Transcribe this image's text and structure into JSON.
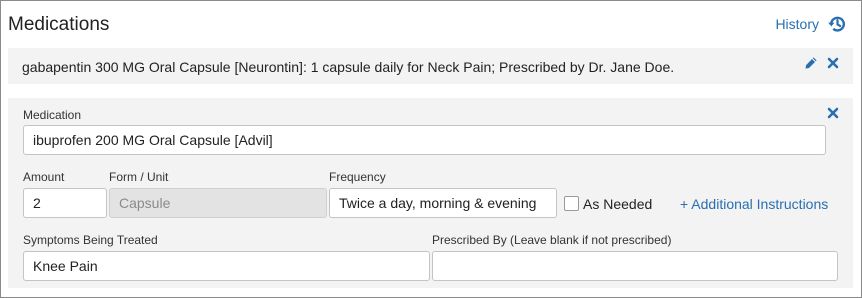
{
  "header": {
    "title": "Medications",
    "history_label": "History",
    "history_icon": "history-icon"
  },
  "existing_medication": {
    "summary": "gabapentin 300 MG Oral Capsule [Neurontin]: 1 capsule daily for Neck Pain; Prescribed by Dr. Jane Doe.",
    "edit_icon": "pencil-icon",
    "remove_icon": "close-icon"
  },
  "form": {
    "close_icon": "close-icon",
    "medication_label": "Medication",
    "medication_value": "ibuprofen 200 MG Oral Capsule [Advil]",
    "amount_label": "Amount",
    "amount_value": "2",
    "form_unit_label": "Form / Unit",
    "form_unit_value": "Capsule",
    "frequency_label": "Frequency",
    "frequency_value": "Twice a day, morning & evening",
    "as_needed_label": "As Needed",
    "as_needed_checked": false,
    "additional_instructions_label": "+ Additional Instructions",
    "symptoms_label": "Symptoms Being Treated",
    "symptoms_value": "Knee Pain",
    "prescribed_by_label": "Prescribed By (Leave blank if not prescribed)",
    "prescribed_by_value": ""
  },
  "colors": {
    "accent": "#2a6fb0",
    "row_background": "#f3f3f3",
    "disabled_background": "#e3e3e3"
  }
}
